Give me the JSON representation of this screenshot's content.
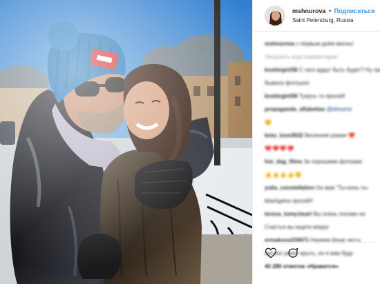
{
  "post": {
    "username": "mshnurova",
    "separator": "•",
    "follow_label": "Подписаться",
    "location": "Saint Petersburg, Russia"
  },
  "comments": [
    {
      "user": "mshnurova",
      "text": "с первым днём весны!",
      "style": "normal"
    },
    {
      "user": "",
      "text": "Загрузить еще комментарии",
      "style": "gray"
    },
    {
      "user": "koshirginf38",
      "text": "С чего вдруг быть будет? Ну просто вы",
      "style": "normal"
    },
    {
      "user": "",
      "text": "бывало фотошоп",
      "style": "normal"
    },
    {
      "user": "koshirginf38",
      "text": "Тужусь то просей!",
      "style": "normal"
    },
    {
      "user": "propaganda_aflabetian",
      "text": "@shnurov",
      "style": "mention"
    },
    {
      "user": "",
      "text": "😊",
      "style": "normal"
    },
    {
      "user": "botu_love3632",
      "text": "Весенняя ражая ❤️",
      "style": "normal"
    },
    {
      "user": "",
      "text": "❤️❤️❤️❤️",
      "style": "emoji"
    },
    {
      "user": "hot_dag_films",
      "text": "За хорошими фотками",
      "style": "normal"
    },
    {
      "user": "",
      "text": "👍👍👍👍🙂",
      "style": "emoji"
    },
    {
      "user": "yulia_constellation",
      "text": "Он вам \"Ты-ночь-ты-",
      "style": "normal"
    },
    {
      "user": "",
      "text": "blashgetra просей!!",
      "style": "normal"
    },
    {
      "user": "teresa_tomy.heart",
      "text": "Вы очень похожи на",
      "style": "normal"
    },
    {
      "user": "",
      "text": "Счастья вы ищете вокруг",
      "style": "normal"
    },
    {
      "user": "ermakova235671",
      "text": "Наумов Шнур честь",
      "style": "normal"
    },
    {
      "user": "",
      "text": "наглое умеет крыть, но я вам буду",
      "style": "normal"
    }
  ],
  "likes_text": "40 280 отметок «Нравится»",
  "icons": {
    "like": "heart-icon",
    "comment": "comment-icon"
  },
  "colors": {
    "accent": "#3897f0",
    "text": "#262626",
    "muted": "#999999"
  }
}
